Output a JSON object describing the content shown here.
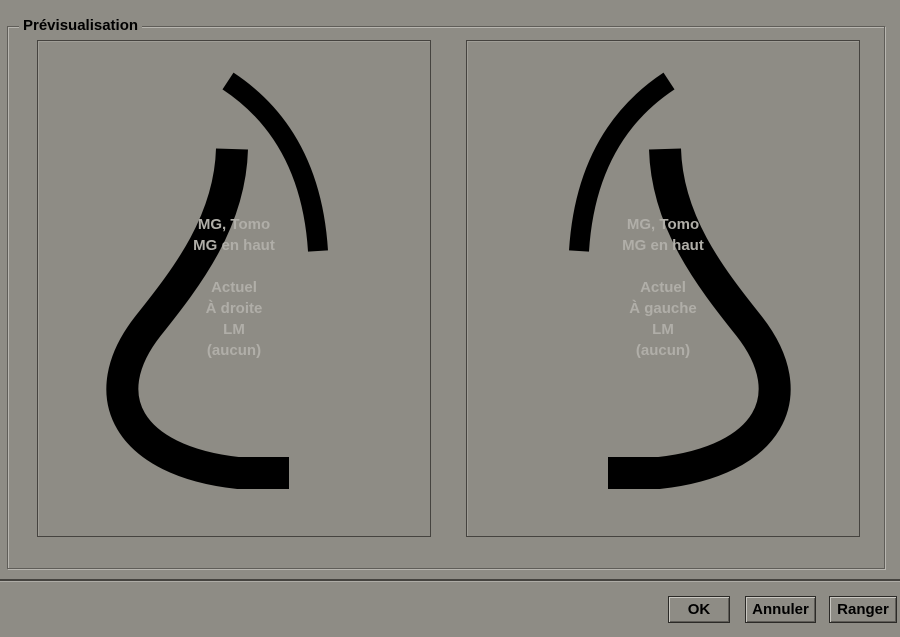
{
  "group_title": "Prévisualisation",
  "left_panel": {
    "line1": "MG, Tomo",
    "line2": "MG en haut",
    "line3": "Actuel",
    "line4": "À droite",
    "line5": "LM",
    "line6": "(aucun)"
  },
  "right_panel": {
    "line1": "MG, Tomo",
    "line2": "MG en haut",
    "line3": "Actuel",
    "line4": "À gauche",
    "line5": "LM",
    "line6": "(aucun)"
  },
  "buttons": {
    "ok": "OK",
    "cancel": "Annuler",
    "store": "Ranger"
  },
  "colors": {
    "background": "#8e8c85",
    "breast_outline": "#000000",
    "overlay_text": "#b0aea8"
  }
}
